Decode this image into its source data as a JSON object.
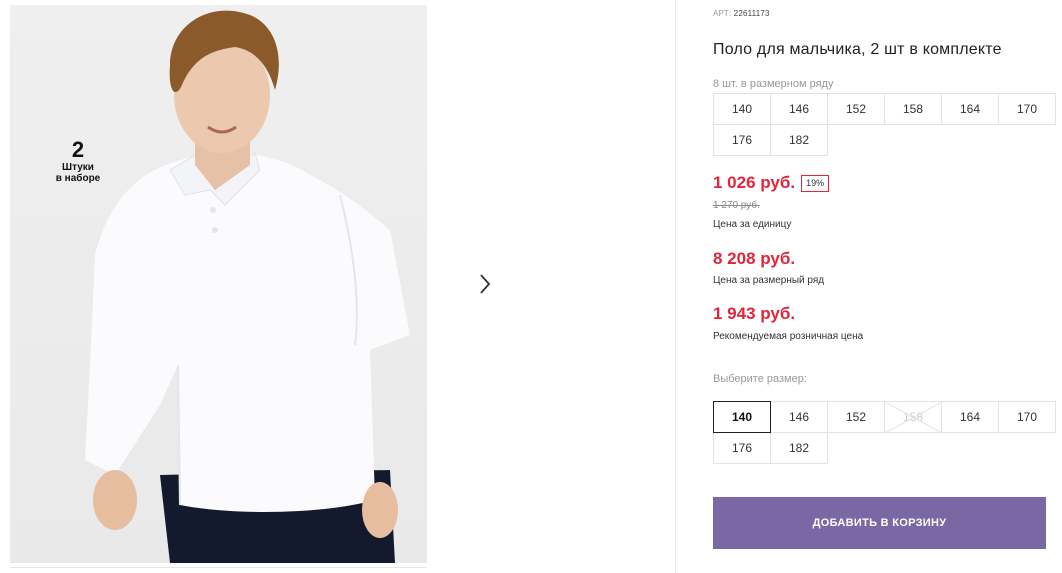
{
  "gallery": {
    "badge": {
      "count": "2",
      "line1": "Штуки",
      "line2": "в наборе"
    },
    "next_icon": "chevron-right-icon"
  },
  "product": {
    "article_label": "АРТ:",
    "article": "22611173",
    "title": "Поло для мальчика, 2 шт в комплекте",
    "range_label": "8 шт. в размерном ряду",
    "range_sizes": [
      "140",
      "146",
      "152",
      "158",
      "164",
      "170",
      "176",
      "182"
    ],
    "price": "1 026 руб.",
    "discount": "19%",
    "old_price": "1 270 руб.",
    "unit_label": "Цена за единицу",
    "range_price": "8 208 руб.",
    "range_price_label": "Цена за размерный ряд",
    "retail_price": "1 943 руб.",
    "retail_label": "Рекомендуемая розничная цена",
    "choose_label": "Выберите размер:",
    "select_sizes": [
      {
        "label": "140",
        "state": "selected"
      },
      {
        "label": "146",
        "state": "available"
      },
      {
        "label": "152",
        "state": "available"
      },
      {
        "label": "158",
        "state": "disabled"
      },
      {
        "label": "164",
        "state": "available"
      },
      {
        "label": "170",
        "state": "available"
      },
      {
        "label": "176",
        "state": "available"
      },
      {
        "label": "182",
        "state": "available"
      }
    ],
    "add_to_cart": "ДОБАВИТЬ В КОРЗИНУ"
  },
  "colors": {
    "price_red": "#e1263c",
    "button_purple": "#7b67a4"
  }
}
